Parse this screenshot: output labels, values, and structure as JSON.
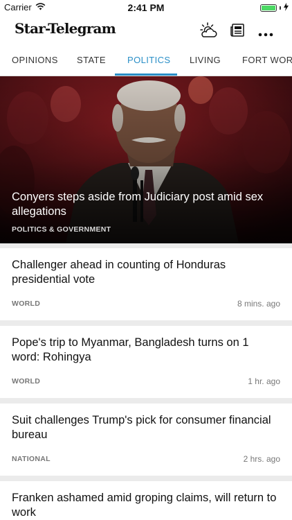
{
  "status_bar": {
    "carrier": "Carrier",
    "time": "2:41 PM",
    "battery_level": 1.0
  },
  "header": {
    "logo": "Star-Telegram",
    "icons": [
      "weather-icon",
      "newspaper-icon",
      "more-icon"
    ]
  },
  "tabs": [
    {
      "label": "OPINIONS"
    },
    {
      "label": "STATE"
    },
    {
      "label": "POLITICS",
      "active": true
    },
    {
      "label": "LIVING"
    },
    {
      "label": "FORT WORT"
    }
  ],
  "hero": {
    "title": "Conyers steps aside from Judiciary post amid sex allegations",
    "category": "POLITICS & GOVERNMENT"
  },
  "articles": [
    {
      "title": "Challenger ahead in counting of Honduras presidential vote",
      "category": "WORLD",
      "time": "8 mins. ago"
    },
    {
      "title": "Pope's trip to Myanmar, Bangladesh turns on 1 word: Rohingya",
      "category": "WORLD",
      "time": "1 hr. ago"
    },
    {
      "title": "Suit challenges Trump's pick for consumer financial bureau",
      "category": "NATIONAL",
      "time": "2 hrs. ago"
    },
    {
      "title": "Franken ashamed amid groping claims, will return to work",
      "category": "",
      "time": ""
    }
  ],
  "colors": {
    "accent": "#2a8fc7",
    "battery": "#4cd964"
  }
}
